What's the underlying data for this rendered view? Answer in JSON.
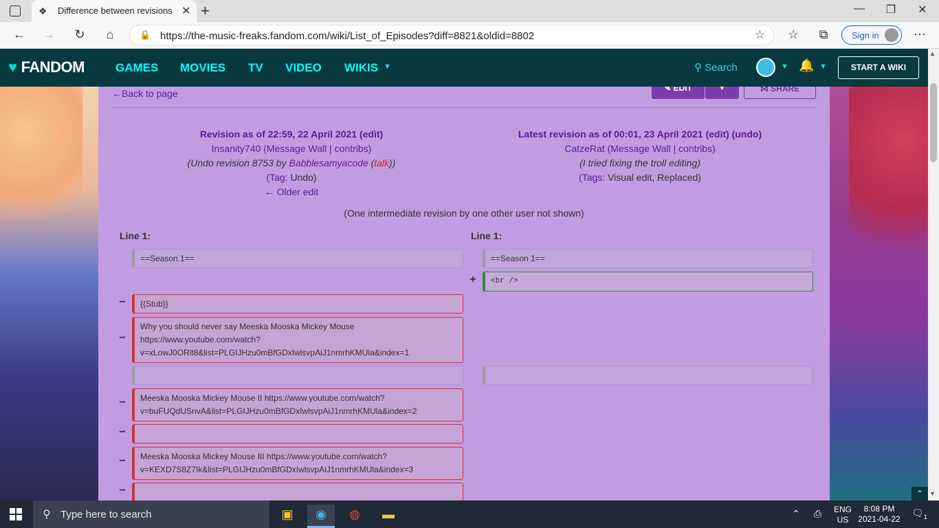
{
  "browser": {
    "tab_title": "Difference between revisions of \"List of Episodes\"",
    "url": "https://the-music-freaks.fandom.com/wiki/List_of_Episodes?diff=8821&oldid=8802",
    "signin_label": "Sign in"
  },
  "fandom": {
    "logo": "FANDOM",
    "nav": [
      "GAMES",
      "MOVIES",
      "TV",
      "VIDEO",
      "WIKIS"
    ],
    "search_label": "Search",
    "start_wiki": "START A WIKI"
  },
  "page": {
    "back_link": "Back to page",
    "edit_label": "EDIT",
    "share_label": "SHARE",
    "left": {
      "title": "Revision as of 22:59, 22 April 2021",
      "edit": "(edit)",
      "user": "Insanity740",
      "user_links": "(Message Wall | contribs)",
      "summary_prefix": "(Undo revision 8753 by",
      "summary_user": "Babblesamyacode",
      "summary_talk": "talk",
      "tag_prefix": "(Tag:",
      "tag_value": "Undo)",
      "older_edit": "← Older edit"
    },
    "right": {
      "title": "Latest revision as of 00:01, 23 April 2021",
      "edit": "(edit)",
      "undo": "(undo)",
      "user": "CatzeRat",
      "user_links": "(Message Wall | contribs)",
      "summary": "(I tried fixing the troll editing)",
      "tag_prefix": "(Tags:",
      "tag_value": "Visual edit, Replaced)"
    },
    "intermediate": "(One intermediate revision by one other user not shown)",
    "line_left": "Line 1:",
    "line_right": "Line 1:",
    "diff": {
      "ctx1_left": "==Season 1==",
      "ctx1_right": "==Season 1==",
      "add1": "<br />",
      "del1": "{{Stub}}",
      "del2": "Why you should never say Meeska Mooska Mickey Mouse https://www.youtube.com/watch?v=xLowJ0ORlt8&list=PLGIJHzu0mBfGDxIwlsvpAiJ1nmrhKMUla&index=1",
      "del3": "Meeska Mooska Mickey Mouse II https://www.youtube.com/watch?v=buFUQdUSnvA&list=PLGIJHzu0mBfGDxIwlsvpAiJ1nmrhKMUla&index=2",
      "del4": "Meeska Mooska Mickey Mouse III https://www.youtube.com/watch?v=KEXD7S8Z7Ik&list=PLGIJHzu0mBfGDxIwlsvpAiJ1nmrhKMUla&index=3",
      "minus": "−",
      "plus": "+"
    }
  },
  "taskbar": {
    "search_placeholder": "Type here to search",
    "lang_top": "ENG",
    "lang_bottom": "US",
    "time": "8:08 PM",
    "date": "2021-04-22",
    "notif_count": "1"
  }
}
